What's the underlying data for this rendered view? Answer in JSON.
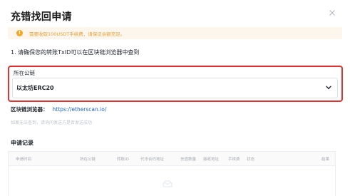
{
  "dialog": {
    "title": "充错找回申请",
    "close_icon": "close-icon"
  },
  "warning": {
    "icon": "info-icon",
    "text": "需要收取100USDT手续费，请保证余额充足。",
    "color": "#e6a23c"
  },
  "step1": {
    "text": "1. 请确保您的转账TxID可以在区块链浏览器中查到"
  },
  "network": {
    "label": "所在公链",
    "value": "以太坊ERC20",
    "icon": "chevron-down-icon",
    "highlight_color": "#e0332f"
  },
  "explorer": {
    "label": "区块链浏览器：",
    "link": "https://etherscan.io/",
    "link_color": "#1e63c8"
  },
  "hint": {
    "text": "如果无法查到，请询问发送方是否发送成功"
  },
  "records": {
    "title": "申请记录",
    "columns": [
      "申请时间",
      "所在公链",
      "转账ID",
      "代币合约地址",
      "充值数量",
      "接收地址",
      "手续费",
      "状态",
      "结果"
    ],
    "empty_icon": "empty-box-icon"
  }
}
